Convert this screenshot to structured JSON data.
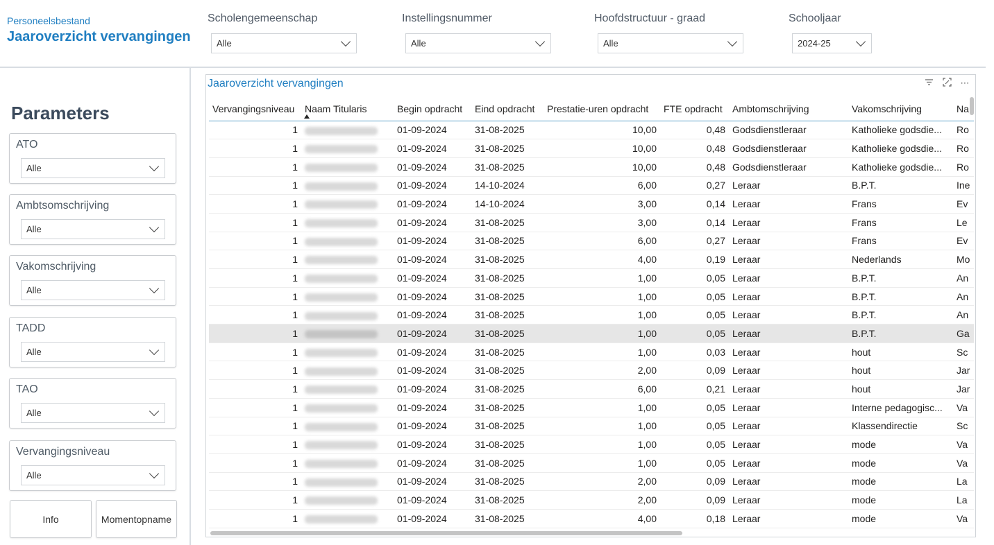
{
  "header": {
    "subtitle": "Personeelsbestand",
    "title": "Jaaroverzicht vervangingen"
  },
  "topfilters": [
    {
      "label": "Scholengemeenschap",
      "value": "Alle"
    },
    {
      "label": "Instellingsnummer",
      "value": "Alle"
    },
    {
      "label": "Hoofdstructuur - graad",
      "value": "Alle"
    },
    {
      "label": "Schooljaar",
      "value": "2024-25"
    }
  ],
  "parameters": {
    "title": "Parameters",
    "filters": [
      {
        "label": "ATO",
        "value": "Alle"
      },
      {
        "label": "Ambtsomschrijving",
        "value": "Alle"
      },
      {
        "label": "Vakomschrijving",
        "value": "Alle"
      },
      {
        "label": "TADD",
        "value": "Alle"
      },
      {
        "label": "TAO",
        "value": "Alle"
      },
      {
        "label": "Vervangingsniveau",
        "value": "Alle"
      }
    ],
    "buttons": {
      "info": "Info",
      "snapshot": "Momentopname"
    }
  },
  "table": {
    "title": "Jaaroverzicht vervangingen",
    "icons": [
      "filter-icon",
      "focus-mode-icon",
      "more-options-icon"
    ],
    "columns": [
      "Vervangingsniveau",
      "Naam Titularis",
      "Begin opdracht",
      "Eind opdracht",
      "Prestatie-uren opdracht",
      "FTE opdracht",
      "Ambtomschrijving",
      "Vakomschrijving",
      "Na"
    ],
    "sorted_column": "Naam Titularis",
    "highlighted_row": 11,
    "rows": [
      [
        "1",
        "",
        "01-09-2024",
        "31-08-2025",
        "10,00",
        "0,48",
        "Godsdienstleraar",
        "Katholieke godsdie...",
        "Ro"
      ],
      [
        "1",
        "",
        "01-09-2024",
        "31-08-2025",
        "10,00",
        "0,48",
        "Godsdienstleraar",
        "Katholieke godsdie...",
        "Ro"
      ],
      [
        "1",
        "",
        "01-09-2024",
        "31-08-2025",
        "10,00",
        "0,48",
        "Godsdienstleraar",
        "Katholieke godsdie...",
        "Ro"
      ],
      [
        "1",
        "",
        "01-09-2024",
        "14-10-2024",
        "6,00",
        "0,27",
        "Leraar",
        "B.P.T.",
        "Ine"
      ],
      [
        "1",
        "",
        "01-09-2024",
        "14-10-2024",
        "3,00",
        "0,14",
        "Leraar",
        "Frans",
        "Ev"
      ],
      [
        "1",
        "",
        "01-09-2024",
        "31-08-2025",
        "3,00",
        "0,14",
        "Leraar",
        "Frans",
        "Le"
      ],
      [
        "1",
        "",
        "01-09-2024",
        "31-08-2025",
        "6,00",
        "0,27",
        "Leraar",
        "Frans",
        "Ev"
      ],
      [
        "1",
        "",
        "01-09-2024",
        "31-08-2025",
        "4,00",
        "0,19",
        "Leraar",
        "Nederlands",
        "Mo"
      ],
      [
        "1",
        "",
        "01-09-2024",
        "31-08-2025",
        "1,00",
        "0,05",
        "Leraar",
        "B.P.T.",
        "An"
      ],
      [
        "1",
        "",
        "01-09-2024",
        "31-08-2025",
        "1,00",
        "0,05",
        "Leraar",
        "B.P.T.",
        "An"
      ],
      [
        "1",
        "",
        "01-09-2024",
        "31-08-2025",
        "1,00",
        "0,05",
        "Leraar",
        "B.P.T.",
        "An"
      ],
      [
        "1",
        "",
        "01-09-2024",
        "31-08-2025",
        "1,00",
        "0,05",
        "Leraar",
        "B.P.T.",
        "Ga"
      ],
      [
        "1",
        "",
        "01-09-2024",
        "31-08-2025",
        "1,00",
        "0,03",
        "Leraar",
        "hout",
        "Sc"
      ],
      [
        "1",
        "",
        "01-09-2024",
        "31-08-2025",
        "2,00",
        "0,09",
        "Leraar",
        "hout",
        "Jar"
      ],
      [
        "1",
        "",
        "01-09-2024",
        "31-08-2025",
        "6,00",
        "0,21",
        "Leraar",
        "hout",
        "Jar"
      ],
      [
        "1",
        "",
        "01-09-2024",
        "31-08-2025",
        "1,00",
        "0,05",
        "Leraar",
        "Interne pedagogisc...",
        "Va"
      ],
      [
        "1",
        "",
        "01-09-2024",
        "31-08-2025",
        "1,00",
        "0,05",
        "Leraar",
        "Klassendirectie",
        "Sc"
      ],
      [
        "1",
        "",
        "01-09-2024",
        "31-08-2025",
        "1,00",
        "0,05",
        "Leraar",
        "mode",
        "Va"
      ],
      [
        "1",
        "",
        "01-09-2024",
        "31-08-2025",
        "1,00",
        "0,05",
        "Leraar",
        "mode",
        "Va"
      ],
      [
        "1",
        "",
        "01-09-2024",
        "31-08-2025",
        "2,00",
        "0,09",
        "Leraar",
        "mode",
        "La"
      ],
      [
        "1",
        "",
        "01-09-2024",
        "31-08-2025",
        "2,00",
        "0,09",
        "Leraar",
        "mode",
        "La"
      ],
      [
        "1",
        "",
        "01-09-2024",
        "31-08-2025",
        "4,00",
        "0,18",
        "Leraar",
        "mode",
        "Va"
      ]
    ]
  }
}
